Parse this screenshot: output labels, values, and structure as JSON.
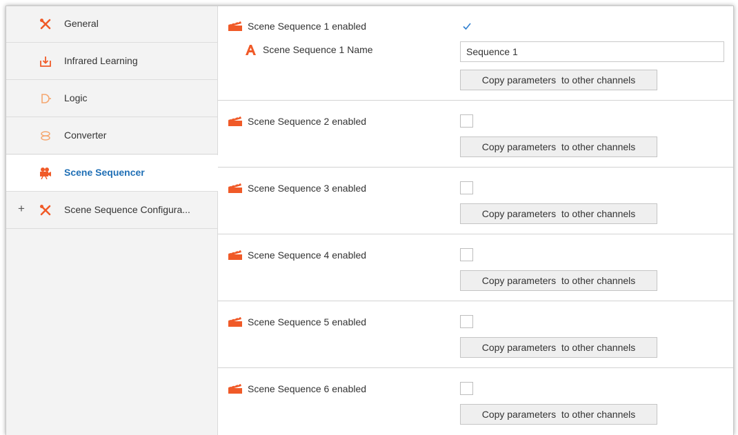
{
  "colors": {
    "accent_orange": "#f05a28",
    "active_blue": "#1f6fb5",
    "check_blue": "#2f7fd0",
    "sidebar_bg": "#f3f3f3"
  },
  "sidebar": {
    "items": [
      {
        "label": "General",
        "icon": "tools-icon",
        "active": false
      },
      {
        "label": "Infrared Learning",
        "icon": "download-icon",
        "active": false
      },
      {
        "label": "Logic",
        "icon": "logic-gate-icon",
        "active": false
      },
      {
        "label": "Converter",
        "icon": "converter-icon",
        "active": false
      },
      {
        "label": "Scene Sequencer",
        "icon": "camera-icon",
        "active": true
      },
      {
        "label": "Scene Sequence Configura...",
        "icon": "tools-icon",
        "active": false,
        "expander": "+"
      }
    ]
  },
  "main": {
    "copy_button_label": "Copy parameters  to other channels",
    "sequences": [
      {
        "label": "Scene Sequence 1 enabled",
        "checked": true,
        "name_label": "Scene Sequence 1 Name",
        "name_value": "Sequence 1"
      },
      {
        "label": "Scene Sequence 2 enabled",
        "checked": false
      },
      {
        "label": "Scene Sequence 3 enabled",
        "checked": false
      },
      {
        "label": "Scene Sequence 4 enabled",
        "checked": false
      },
      {
        "label": "Scene Sequence 5 enabled",
        "checked": false
      },
      {
        "label": "Scene Sequence 6 enabled",
        "checked": false
      }
    ]
  }
}
